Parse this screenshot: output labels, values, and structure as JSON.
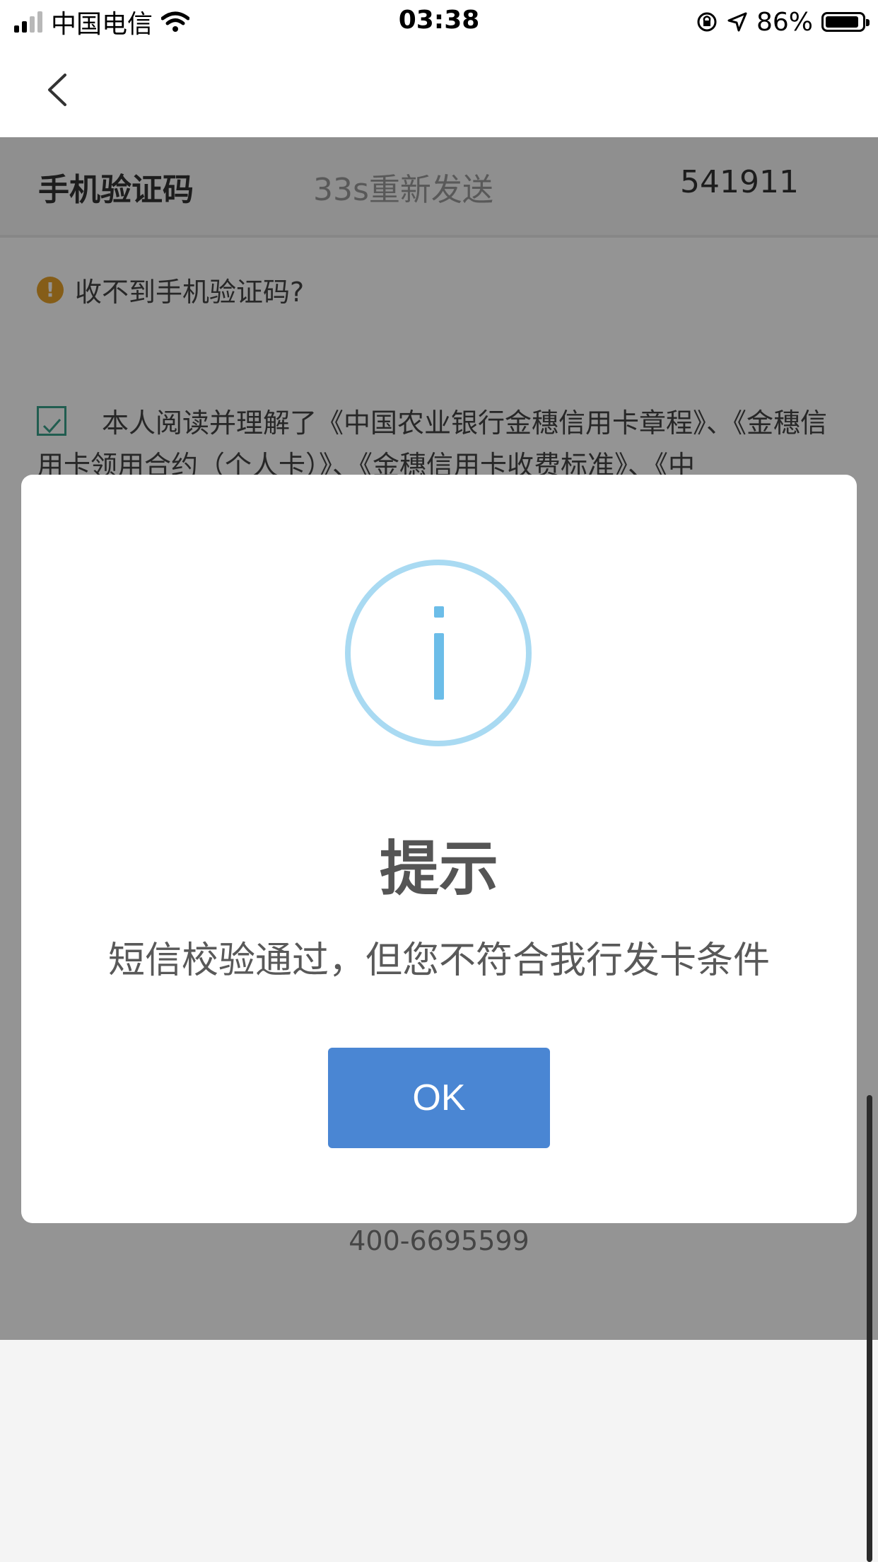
{
  "status": {
    "carrier": "中国电信",
    "time": "03:38",
    "battery": "86%"
  },
  "page": {
    "code_label": "手机验证码",
    "countdown": "33s重新发送",
    "code_value": "541911",
    "tip": "收不到手机验证码?",
    "agreement": "本人阅读并理解了《中国农业银行金穗信用卡章程》、《金穗信用卡领用合约（个人卡）》、《金穗信用卡收费标准》、《中",
    "hotline": "400-6695599"
  },
  "dialog": {
    "title": "提示",
    "message": "短信校验通过，但您不符合我行发卡条件",
    "ok_label": "OK"
  }
}
